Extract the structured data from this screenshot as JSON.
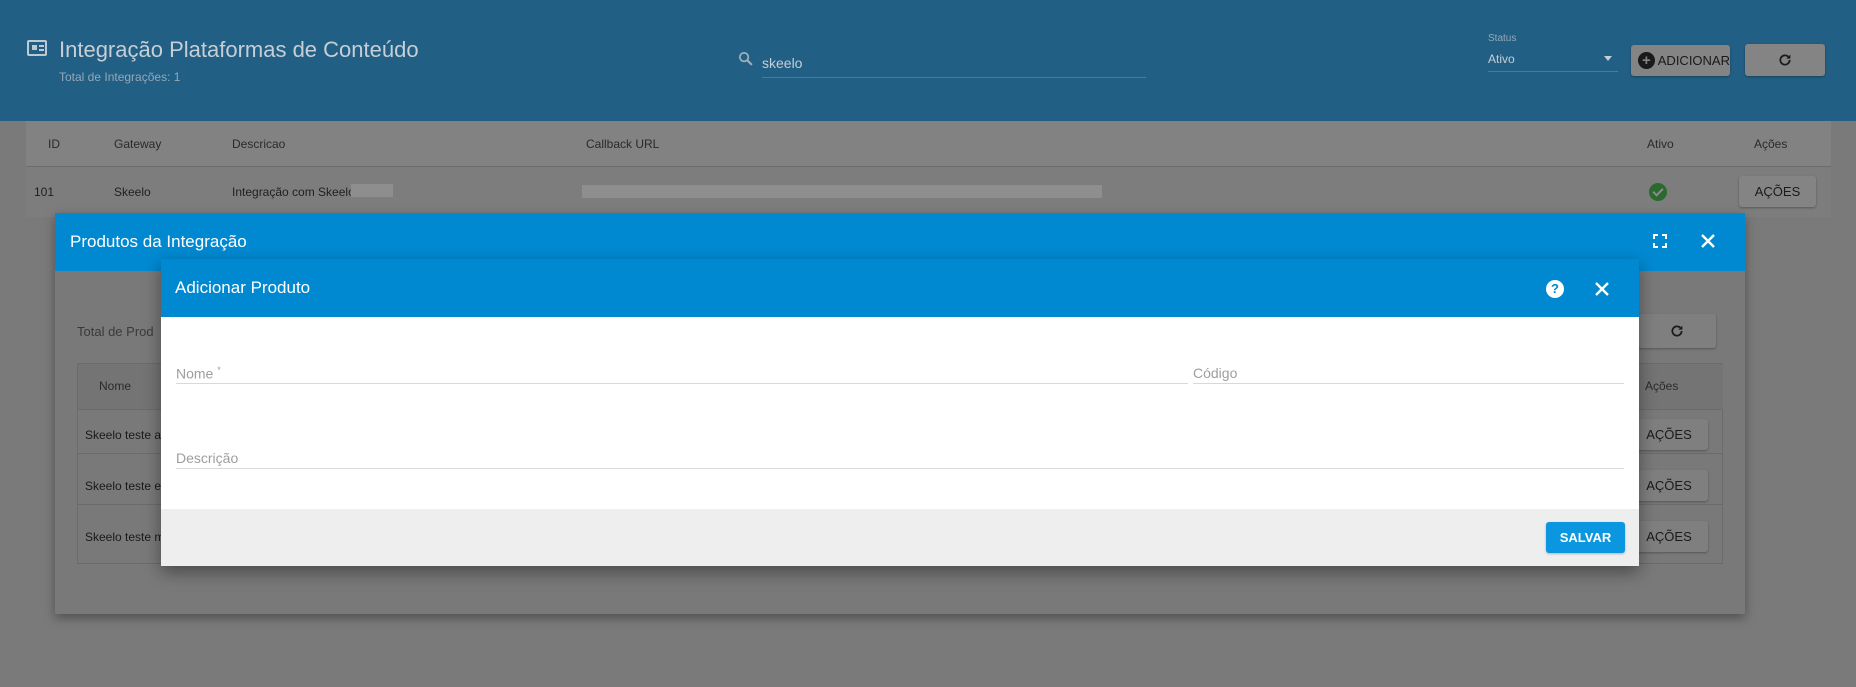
{
  "page": {
    "title": "Integração Plataformas de Conteúdo",
    "subtitle": "Total de Integrações: 1",
    "search_value": "skeelo",
    "status_label": "Status",
    "status_value": "Ativo",
    "add_label": "ADICIONAR",
    "table": {
      "headers": [
        "ID",
        "Gateway",
        "Descricao",
        "Callback URL",
        "Ativo",
        "Ações"
      ],
      "row": {
        "id": "101",
        "gateway": "Skeelo",
        "descricao": "Integração com Skeelo",
        "acoes_label": "AÇÕES"
      }
    }
  },
  "products_dialog": {
    "title": "Produtos da Integração",
    "total_label": "Total de Prod",
    "headers": {
      "nome": "Nome",
      "acoes": "Ações"
    },
    "rows": [
      {
        "nome": "Skeelo teste au",
        "acoes_label": "AÇÕES"
      },
      {
        "nome": "Skeelo teste eb",
        "acoes_label": "AÇÕES"
      },
      {
        "nome": "Skeelo teste m",
        "acoes_label": "AÇÕES"
      }
    ]
  },
  "add_dialog": {
    "title": "Adicionar Produto",
    "nome_label": "Nome",
    "required_mark": "*",
    "codigo_label": "Código",
    "descricao_label": "Descrição",
    "save_label": "SALVAR"
  },
  "colors": {
    "header_bg": "#225f84",
    "dialog_header": "#0089d1",
    "save_button": "#0b97df",
    "active_ok": "#2a6a2f"
  }
}
